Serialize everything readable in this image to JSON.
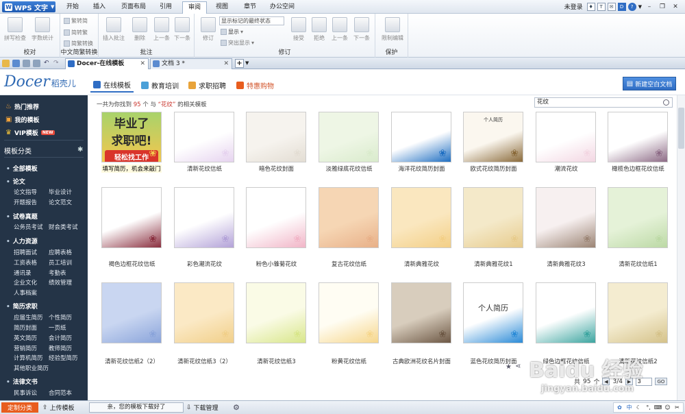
{
  "app": {
    "title": "WPS 文字"
  },
  "menu": {
    "tabs": [
      "开始",
      "插入",
      "页面布局",
      "引用",
      "审阅",
      "视图",
      "章节",
      "办公空间"
    ],
    "active": "审阅",
    "login": "未登录"
  },
  "ribbon": {
    "proof": {
      "group": "校对",
      "spell": "拼写检查",
      "count": "字数统计"
    },
    "convert": {
      "group": "中文简繁转换",
      "to_trad": "繁转简",
      "to_simp": "简转繁",
      "conv": "简繁转换"
    },
    "comment": {
      "group": "批注",
      "insert": "插入批注",
      "delete": "删除",
      "prev": "上一条",
      "next": "下一条"
    },
    "revise": {
      "group": "修订",
      "revise": "修订",
      "select": "显示标记的最终状态",
      "show": "显示",
      "highlight": "突出显示",
      "accept": "接受",
      "reject": "拒绝",
      "prev": "上一条",
      "next": "下一条"
    },
    "protect": {
      "group": "保护",
      "limit": "限制编辑"
    }
  },
  "doctabs": [
    {
      "label": "Docer-在线模板"
    },
    {
      "label": "文档 3 *"
    }
  ],
  "docer": {
    "logo": "Docer",
    "logo_cn": "稻壳儿",
    "nav": [
      "在线模板",
      "教育培训",
      "求职招聘",
      "特惠购物"
    ],
    "nav_active": "在线模板",
    "new_doc": "新建空白文档"
  },
  "sidebar": {
    "top": [
      "热门推荐",
      "我的模板",
      "VIP模板"
    ],
    "new_badge": "NEW",
    "category_title": "模板分类",
    "cats": [
      {
        "name": "全部模板",
        "items": []
      },
      {
        "name": "论文",
        "items": [
          "论文指导",
          "毕业设计",
          "开题报告",
          "论文范文"
        ]
      },
      {
        "name": "试卷真题",
        "items": [
          "公务员考试",
          "财会类考试"
        ]
      },
      {
        "name": "人力资源",
        "items": [
          "招聘面试",
          "应聘表格",
          "工资表格",
          "员工培训",
          "通讯录",
          "考勤表",
          "企业文化",
          "绩效管理",
          "人事档案"
        ]
      },
      {
        "name": "简历求职",
        "items": [
          "应届生简历",
          "个性简历",
          "简历封面",
          "一页纸",
          "英文简历",
          "会计简历",
          "营销简历",
          "教师简历",
          "计算机简历",
          "经验型简历",
          "其他职业简历"
        ]
      },
      {
        "name": "法律文书",
        "items": [
          "民事诉讼",
          "合同范本"
        ]
      }
    ]
  },
  "results": {
    "prefix": "一共为你找到",
    "count": "95",
    "unit": "个 与",
    "keyword": "“花纹”",
    "suffix": "的相关模板",
    "search_value": "花纹"
  },
  "templates": [
    {
      "label": "填写简历，机会来敲门",
      "ad": true,
      "ad_line1": "毕业了",
      "ad_line2": "求职吧!",
      "ad_btn": "轻松找工作",
      "colors": [
        "#a8d36b",
        "#f3c64e"
      ]
    },
    {
      "label": "清新花纹信纸",
      "colors": [
        "#ffffff",
        "#e6d3ef"
      ]
    },
    {
      "label": "暗色花纹封面",
      "colors": [
        "#f6f3ee",
        "#e3ddd3"
      ]
    },
    {
      "label": "淡雅绿底花纹信纸",
      "colors": [
        "#eef6e5",
        "#d9ebcc"
      ]
    },
    {
      "label": "海洋花纹简历封面",
      "colors": [
        "#ffffff",
        "#1f6fc2"
      ]
    },
    {
      "label": "欧式花纹简历封面",
      "colors": [
        "#fbf7ef",
        "#8a6a3a"
      ],
      "inner": "个人简历"
    },
    {
      "label": "潮流花纹",
      "colors": [
        "#ffffff",
        "#f3d6e2"
      ]
    },
    {
      "label": "橄榄色边框花纹信纸",
      "colors": [
        "#ffffff",
        "#8d6b86"
      ]
    },
    {
      "label": "褐色边框花纹信纸",
      "colors": [
        "#ffffff",
        "#8a2f3f"
      ]
    },
    {
      "label": "彩色潮流花纹",
      "colors": [
        "#ffffff",
        "#b3a2d8"
      ]
    },
    {
      "label": "粉色小雏菊花纹",
      "colors": [
        "#ffffff",
        "#f1b5c7"
      ]
    },
    {
      "label": "复古花纹信纸",
      "colors": [
        "#f6d6b4",
        "#e8b088"
      ]
    },
    {
      "label": "清新典雅花纹",
      "colors": [
        "#fae7bf",
        "#f3cf86"
      ]
    },
    {
      "label": "清新典雅花纹1",
      "colors": [
        "#f4e9c9",
        "#e7cb8c"
      ]
    },
    {
      "label": "清新典雅花纹3",
      "colors": [
        "#f7f0f0",
        "#9b8474"
      ]
    },
    {
      "label": "清新花纹信纸1",
      "colors": [
        "#e5f2d8",
        "#bcd9a5"
      ]
    },
    {
      "label": "清新花纹信纸2（2）",
      "colors": [
        "#c9d6f1",
        "#8aa4da"
      ]
    },
    {
      "label": "清新花纹信纸3（2）",
      "colors": [
        "#fbe9c5",
        "#f1cf89"
      ]
    },
    {
      "label": "清新花纹信纸3",
      "colors": [
        "#fafbe6",
        "#d8e68a"
      ]
    },
    {
      "label": "粉黄花纹信纸",
      "colors": [
        "#fffdf3",
        "#f6d68b"
      ]
    },
    {
      "label": "古典欧洲花纹名片封面",
      "colors": [
        "#d8cdbd",
        "#6d5845"
      ]
    },
    {
      "label": "蓝色花纹简历封面",
      "colors": [
        "#ffffff",
        "#2b8bd7"
      ],
      "inner": "个人简历",
      "selected": true
    },
    {
      "label": "绿色边框花纹信纸",
      "colors": [
        "#ffffff",
        "#3ca5a0"
      ]
    },
    {
      "label": "清新花纹信纸2",
      "colors": [
        "#f4ecd0",
        "#d5c28a"
      ]
    }
  ],
  "pager": {
    "total_prefix": "共",
    "total": "95",
    "total_suffix": "个",
    "page": "3/4",
    "goto": "3",
    "go": "GO"
  },
  "status": {
    "custom": "定制分类",
    "upload": "上传模板",
    "message": "亲，您的模板下载好了",
    "download": "下载管理",
    "ime": "中"
  },
  "accent": "#2f6dc4",
  "sidebar_bg": "#243447",
  "watermark": {
    "brand": "Baidu 经验",
    "url": "jingyan.baidu.com"
  }
}
